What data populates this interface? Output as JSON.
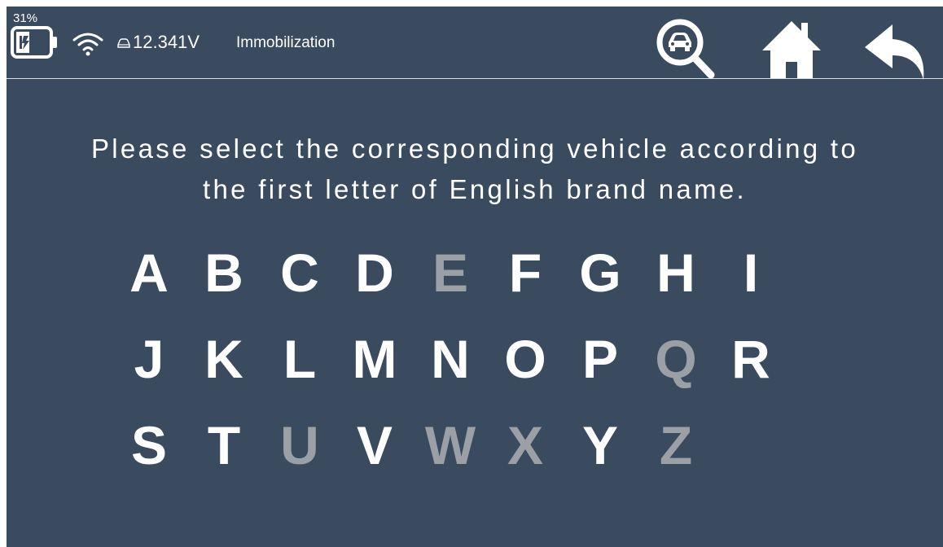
{
  "status_bar": {
    "battery_percent": "31%",
    "voltage": "12.341V",
    "title": "Immobilization"
  },
  "toolbar": {
    "search_icon": "car-search-icon",
    "home_icon": "home-icon",
    "back_icon": "back-arrow-icon"
  },
  "instruction": {
    "line1": "Please select the corresponding vehicle according to",
    "line2": "the first letter of English brand name."
  },
  "letter_rows": [
    [
      {
        "letter": "A",
        "enabled": true
      },
      {
        "letter": "B",
        "enabled": true
      },
      {
        "letter": "C",
        "enabled": true
      },
      {
        "letter": "D",
        "enabled": true
      },
      {
        "letter": "E",
        "enabled": false
      },
      {
        "letter": "F",
        "enabled": true
      },
      {
        "letter": "G",
        "enabled": true
      },
      {
        "letter": "H",
        "enabled": true
      },
      {
        "letter": "I",
        "enabled": true
      }
    ],
    [
      {
        "letter": "J",
        "enabled": true
      },
      {
        "letter": "K",
        "enabled": true
      },
      {
        "letter": "L",
        "enabled": true
      },
      {
        "letter": "M",
        "enabled": true
      },
      {
        "letter": "N",
        "enabled": true
      },
      {
        "letter": "O",
        "enabled": true
      },
      {
        "letter": "P",
        "enabled": true
      },
      {
        "letter": "Q",
        "enabled": false
      },
      {
        "letter": "R",
        "enabled": true
      }
    ],
    [
      {
        "letter": "S",
        "enabled": true
      },
      {
        "letter": "T",
        "enabled": true
      },
      {
        "letter": "U",
        "enabled": false
      },
      {
        "letter": "V",
        "enabled": true
      },
      {
        "letter": "W",
        "enabled": false
      },
      {
        "letter": "X",
        "enabled": false
      },
      {
        "letter": "Y",
        "enabled": true
      },
      {
        "letter": "Z",
        "enabled": false
      }
    ]
  ],
  "colors": {
    "background": "#3a4a5f",
    "enabled_letter": "#ffffff",
    "disabled_letter": "#9aa0a6"
  }
}
